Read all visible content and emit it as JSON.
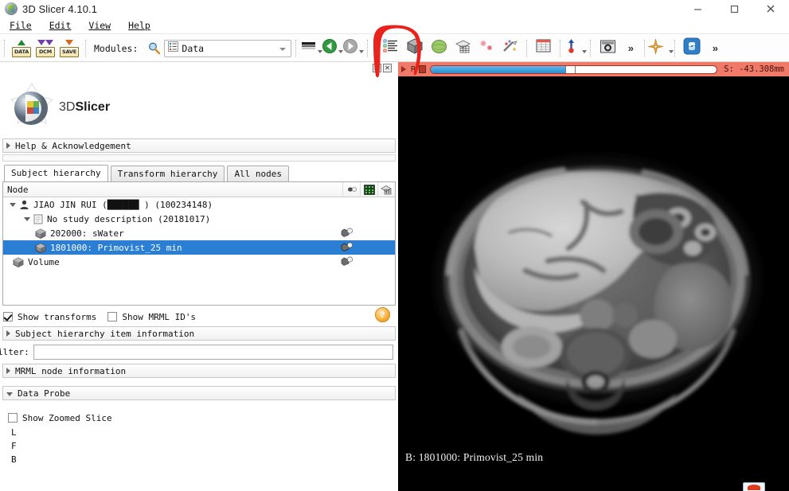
{
  "window": {
    "title": "3D Slicer 4.10.1",
    "app_icon": "slicer-logo-icon",
    "minimize_label": "minimize-icon",
    "maximize_label": "maximize-icon",
    "close_label": "close-icon"
  },
  "menu": {
    "items": [
      {
        "label": "File",
        "mnemonic": "F"
      },
      {
        "label": "Edit",
        "mnemonic": "E"
      },
      {
        "label": "View",
        "mnemonic": "V"
      },
      {
        "label": "Help",
        "mnemonic": "H"
      }
    ]
  },
  "toolbar": {
    "load_data_label": "DATA",
    "load_dicom_label": "DCM",
    "save_data_label": "SAVE",
    "modules_label": "Modules:",
    "module_search_icon": "magnifier-icon",
    "module_current": "Data",
    "module_icon": "data-module-icon",
    "history_icon": "module-history-icon",
    "back_icon": "back-arrow-icon",
    "forward_icon": "forward-arrow-icon",
    "layout_icon": "layout-chooser-icon",
    "volume_rendering_icon": "volume-cube-icon",
    "models_icon": "models-sphere-icon",
    "segment_editor_icon": "segment-editor-icon",
    "markups_icon": "markups-star-icon",
    "annotations_icon": "annotation-pencil-icon",
    "tables_icon": "tables-icon",
    "fiducial_icon": "fiducial-pin-icon",
    "screenshot_icon": "screenshot-camera-icon",
    "overflow_icon": "chevron-double-right-icon",
    "crosshair_icon": "crosshair-icon",
    "python_icon": "python-console-icon",
    "overflow2_icon": "chevron-double-right-icon"
  },
  "annotation": {
    "shape": "red-hand-drawn-circle",
    "color": "#e8231c",
    "target": "layout-chooser-icon"
  },
  "slice_controller": {
    "visibility_icon": "eye-closed-icon",
    "pin_icon": "pin-icon",
    "orientation_letter": "R",
    "offset_label": "S:",
    "offset_value": "-43.308mm",
    "offset_display": "S: -43.308mm",
    "slider_percent": 47,
    "bg_color": "#f07a6a",
    "popup_icon": "popup-window-icon",
    "close_icon": "close-small-icon"
  },
  "left_panel": {
    "logo_text_prefix": "3D",
    "logo_text_suffix": "Slicer",
    "logo_icon": "slicer-3d-logo-icon",
    "help_section": {
      "title": "Help & Acknowledgement",
      "expanded": false
    },
    "tabs": [
      {
        "label": "Subject hierarchy",
        "active": true
      },
      {
        "label": "Transform hierarchy",
        "active": false
      },
      {
        "label": "All nodes",
        "active": false
      }
    ],
    "tree": {
      "header": "Node",
      "header_icons": [
        "visibility-column-icon",
        "color-column-icon",
        "transform-column-icon"
      ],
      "rows": [
        {
          "label": "JIAO JIN RUI (██████ ) (100234148)",
          "indent": 0,
          "expander": "expanded",
          "icon": "patient-icon",
          "selected": false,
          "has_eye": false
        },
        {
          "label": "No study description (20181017)",
          "indent": 1,
          "expander": "expanded",
          "icon": "study-icon",
          "selected": false,
          "has_eye": false
        },
        {
          "label": "202000: sWater",
          "indent": 2,
          "expander": "none",
          "icon": "volume-icon",
          "selected": false,
          "has_eye": true
        },
        {
          "label": "1801000: Primovist_25 min",
          "indent": 2,
          "expander": "none",
          "icon": "volume-icon",
          "selected": true,
          "has_eye": true
        },
        {
          "label": "Volume",
          "indent": 0,
          "expander": "none",
          "icon": "volume-icon",
          "selected": false,
          "has_eye": true
        }
      ]
    },
    "show_transforms": {
      "label": "Show transforms",
      "checked": true
    },
    "show_mrml_ids": {
      "label": "Show MRML ID's",
      "checked": false
    },
    "help_button_icon": "help-question-icon",
    "item_information": {
      "title": "Subject hierarchy item information",
      "expanded": false
    },
    "filter": {
      "label": "ilter:",
      "value": "",
      "placeholder": ""
    },
    "mrml_node_information": {
      "title": "MRML node information",
      "expanded": false
    },
    "data_probe": {
      "title": "Data Probe",
      "expanded": true,
      "show_zoomed_slice": {
        "label": "Show Zoomed Slice",
        "checked": false
      },
      "rows": [
        "L",
        "F",
        "B"
      ]
    }
  },
  "viewport": {
    "label": "B: 1801000: Primovist_25 min",
    "background": "#000000",
    "image_description": "axial-abdominal-mri-slice"
  },
  "colors": {
    "selection_blue": "#2a7fd4",
    "slice_red": "#f07a6a",
    "annotation_red": "#e8231c"
  }
}
